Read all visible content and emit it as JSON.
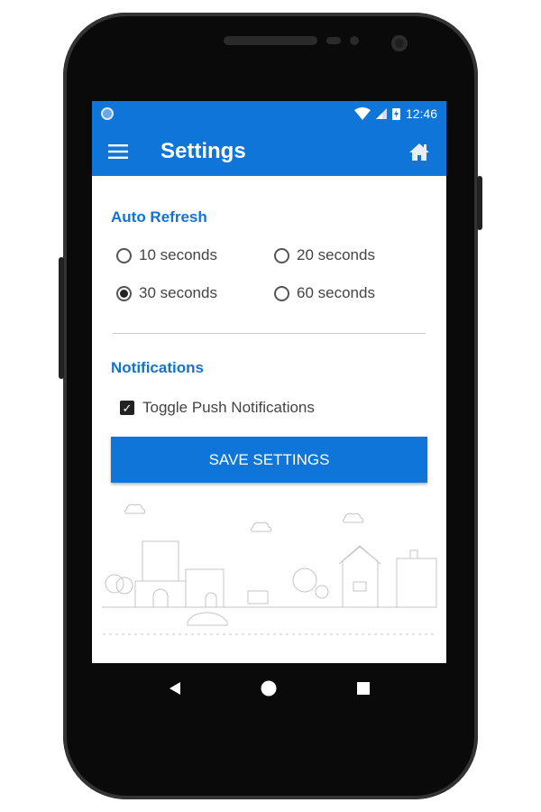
{
  "status_bar": {
    "time": "12:46",
    "icons": [
      "notification-dot-icon",
      "wifi-icon",
      "signal-icon",
      "battery-charging-icon"
    ]
  },
  "app_bar": {
    "title": "Settings",
    "menu_icon": "hamburger-menu-icon",
    "home_icon": "home-icon"
  },
  "auto_refresh": {
    "heading": "Auto Refresh",
    "options": [
      {
        "label": "10 seconds",
        "selected": false
      },
      {
        "label": "20 seconds",
        "selected": false
      },
      {
        "label": "30 seconds",
        "selected": true
      },
      {
        "label": "60 seconds",
        "selected": false
      }
    ]
  },
  "notifications": {
    "heading": "Notifications",
    "toggle_label": "Toggle Push Notifications",
    "checked": true
  },
  "save_button": {
    "label": "SAVE SETTINGS"
  },
  "nav_bar": {
    "icons": [
      "back-icon",
      "home-circle-icon",
      "recents-icon"
    ]
  },
  "colors": {
    "accent": "#0f75d8",
    "heading": "#1273d4"
  }
}
